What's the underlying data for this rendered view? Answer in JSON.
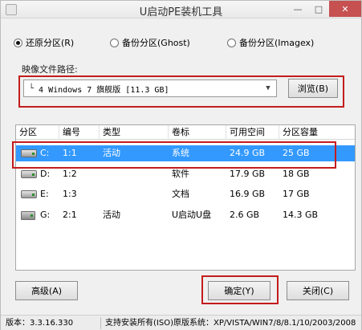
{
  "window": {
    "title": "U启动PE装机工具",
    "minimize_glyph": "—",
    "maximize_glyph": "□",
    "close_glyph": "✕"
  },
  "modes": [
    {
      "label": "还原分区(R)",
      "checked": true
    },
    {
      "label": "备份分区(Ghost)",
      "checked": false
    },
    {
      "label": "备份分区(Imagex)",
      "checked": false
    }
  ],
  "image_path": {
    "label": "映像文件路径:",
    "corner_glyph": "└",
    "value": "4 Windows 7 旗舰版 [11.3 GB]",
    "dropdown_glyph": "▼",
    "browse_label": "浏览(B)"
  },
  "partition_table": {
    "columns": [
      "分区",
      "编号",
      "类型",
      "卷标",
      "可用空间",
      "分区容量"
    ],
    "rows": [
      {
        "drive": "C:",
        "number": "1:1",
        "type": "活动",
        "label": "系统",
        "free": "24.9 GB",
        "capacity": "25 GB",
        "selected": true,
        "icon": "hard-disk-icon"
      },
      {
        "drive": "D:",
        "number": "1:2",
        "type": "",
        "label": "软件",
        "free": "17.9 GB",
        "capacity": "18 GB",
        "selected": false,
        "icon": "hard-disk-icon"
      },
      {
        "drive": "E:",
        "number": "1:3",
        "type": "",
        "label": "文档",
        "free": "16.9 GB",
        "capacity": "17 GB",
        "selected": false,
        "icon": "hard-disk-icon"
      },
      {
        "drive": "G:",
        "number": "2:1",
        "type": "活动",
        "label": "U启动U盘",
        "free": "2.6 GB",
        "capacity": "14.3 GB",
        "selected": false,
        "icon": "usb-drive-icon"
      }
    ]
  },
  "buttons": {
    "advanced": "高级(A)",
    "confirm": "确定(Y)",
    "close": "关闭(C)"
  },
  "status": {
    "version": "版本：3.3.16.330",
    "support": "支持安装所有(ISO)原版系统：XP/VISTA/WIN7/8/8.1/10/2003/2008"
  },
  "colors": {
    "selection": "#3399ff",
    "highlight_box": "#c41c1c",
    "close_button": "#c75050"
  }
}
